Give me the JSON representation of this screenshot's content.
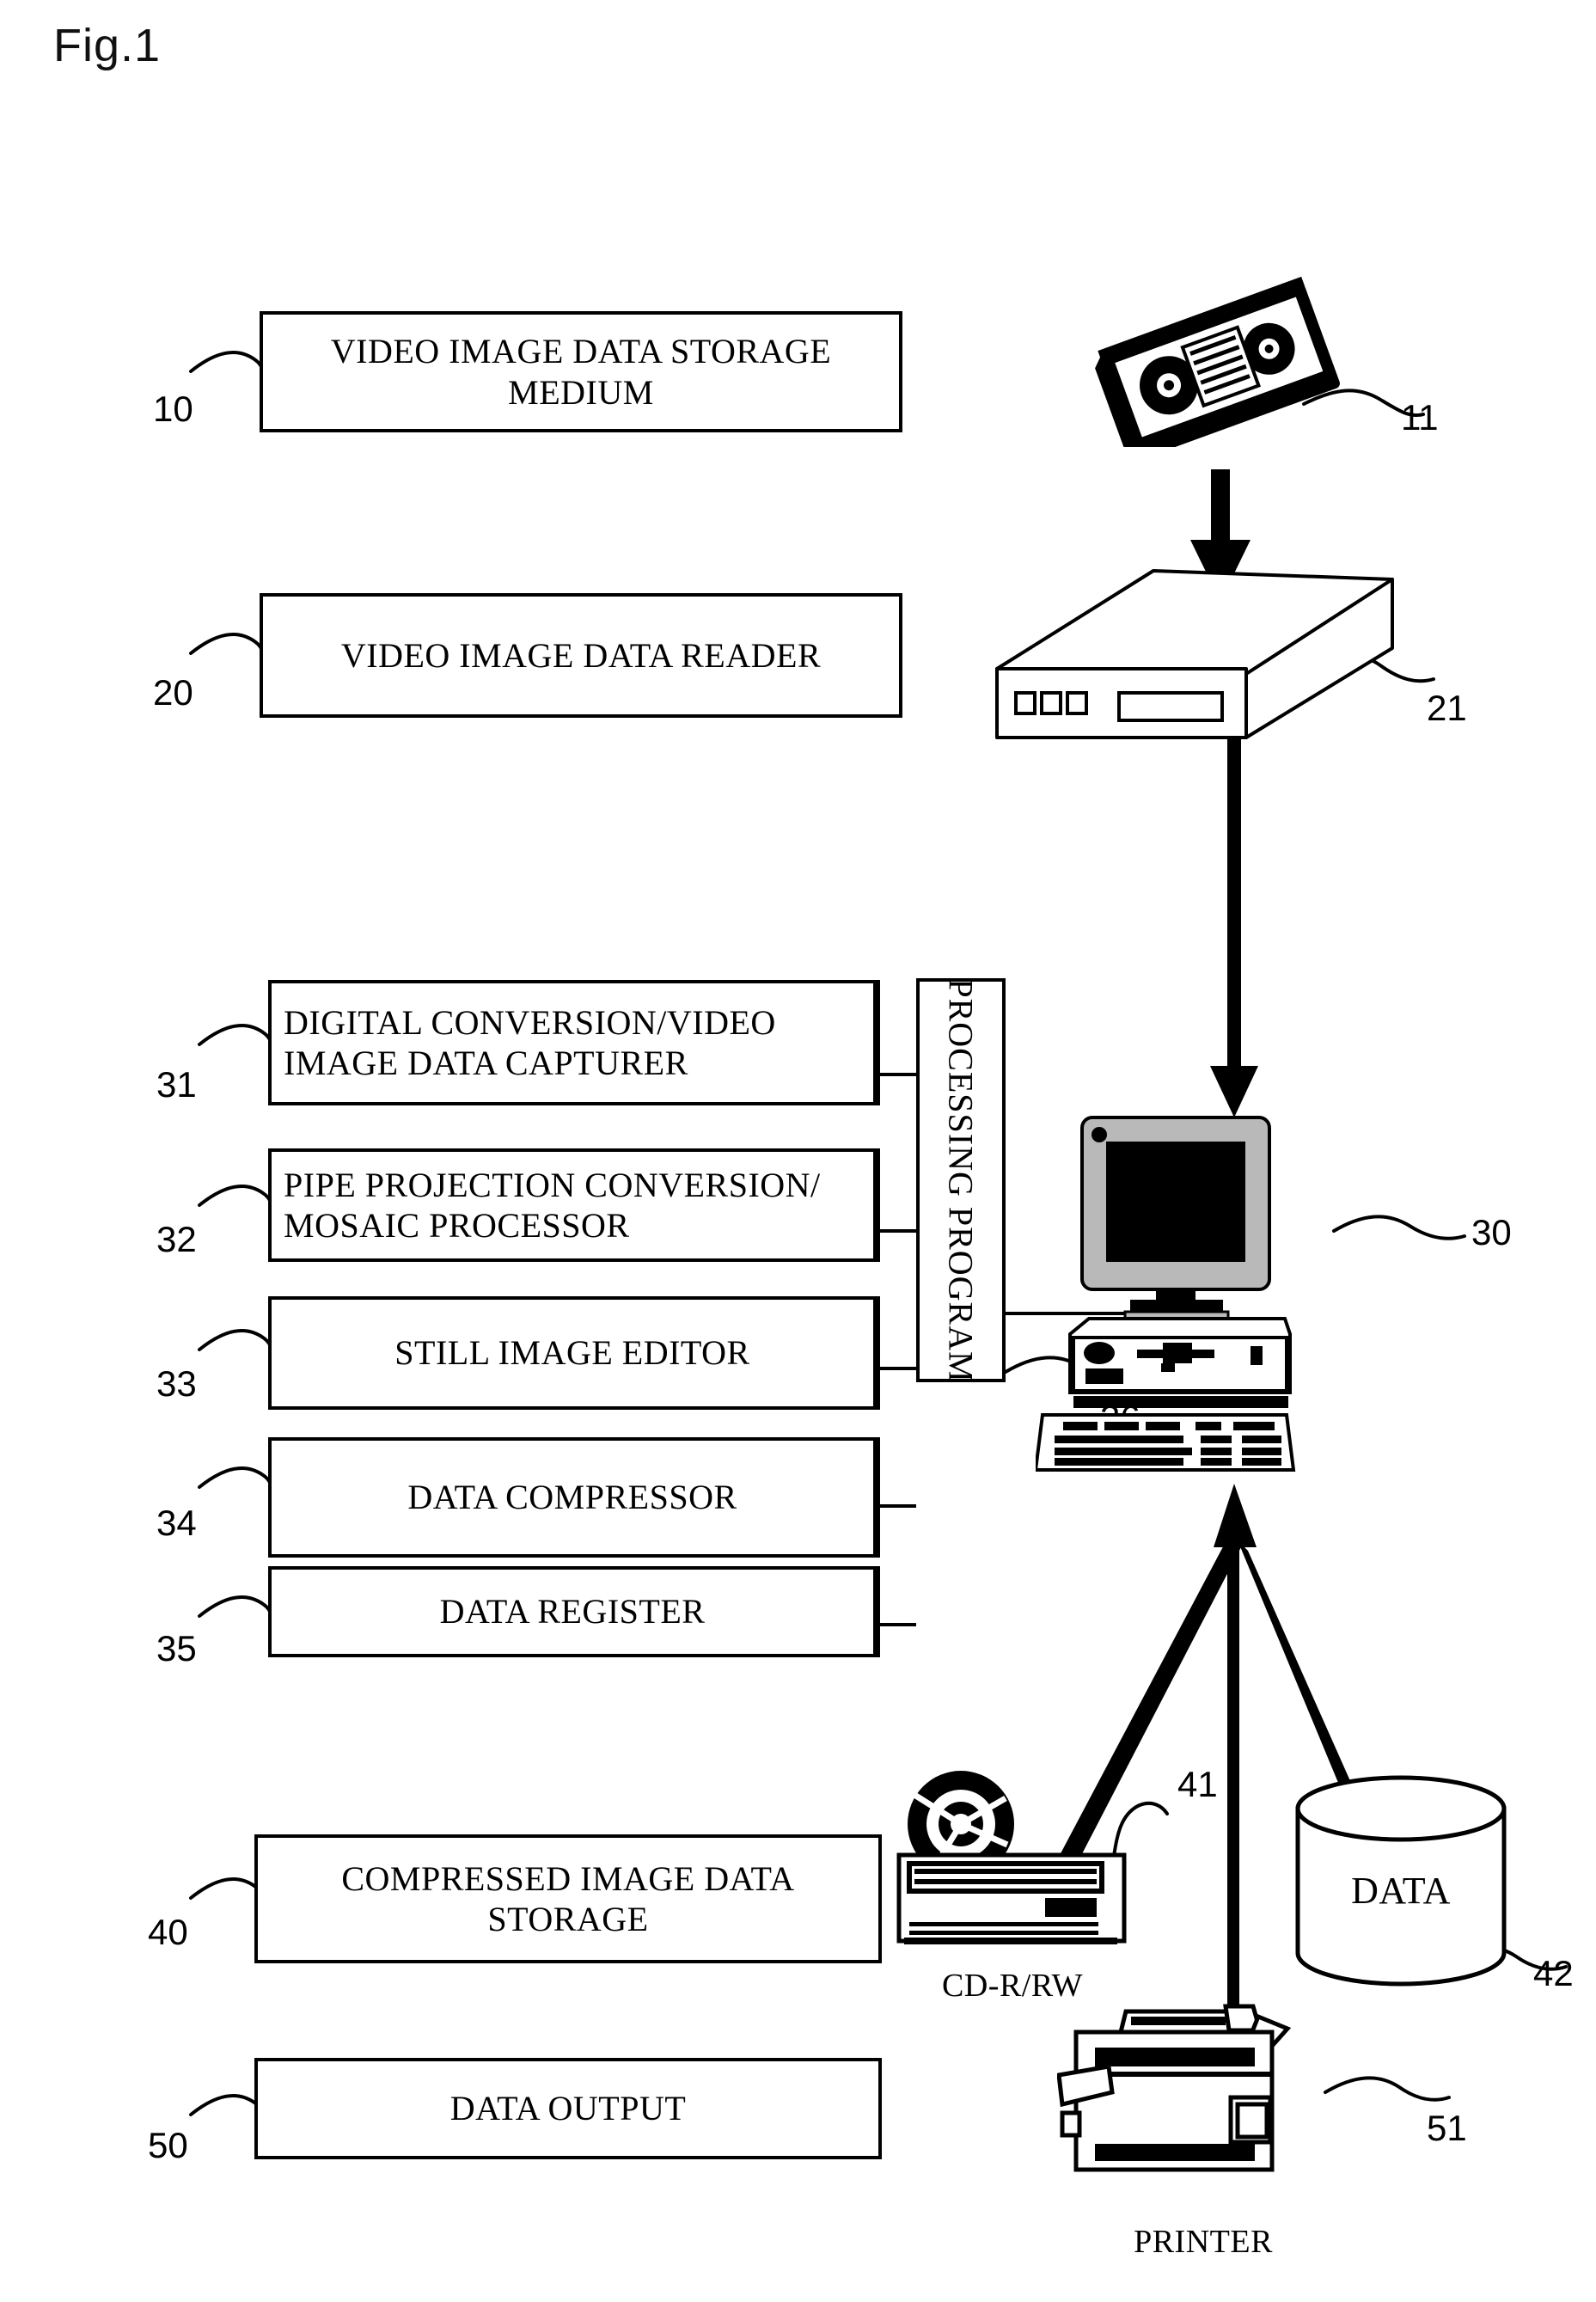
{
  "figure": {
    "label": "Fig.1"
  },
  "blocks": [
    {
      "id": "10",
      "ref": "10",
      "label": "VIDEO IMAGE DATA STORAGE MEDIUM",
      "align": "center"
    },
    {
      "id": "20",
      "ref": "20",
      "label": "VIDEO IMAGE DATA READER",
      "align": "center"
    },
    {
      "id": "31",
      "ref": "31",
      "label": "DIGITAL CONVERSION/VIDEO IMAGE DATA CAPTURER",
      "align": "left"
    },
    {
      "id": "32",
      "ref": "32",
      "label": "PIPE PROJECTION CONVERSION/ MOSAIC PROCESSOR",
      "align": "left"
    },
    {
      "id": "33",
      "ref": "33",
      "label": "STILL IMAGE EDITOR",
      "align": "center"
    },
    {
      "id": "34",
      "ref": "34",
      "label": "DATA COMPRESSOR",
      "align": "center"
    },
    {
      "id": "35",
      "ref": "35",
      "label": "DATA REGISTER",
      "align": "center"
    },
    {
      "id": "40",
      "ref": "40",
      "label": "COMPRESSED IMAGE DATA STORAGE",
      "align": "center"
    },
    {
      "id": "50",
      "ref": "50",
      "label": "DATA OUTPUT",
      "align": "center"
    }
  ],
  "processing_program": {
    "ref": "36",
    "label": "PROCESSING PROGRAM"
  },
  "pictorials": {
    "videotape": {
      "ref": "11",
      "name": "video-cassette-tape"
    },
    "video_deck": {
      "ref": "21",
      "name": "video-deck"
    },
    "computer": {
      "ref": "30",
      "name": "desktop-computer"
    },
    "cd_drive": {
      "ref": "41",
      "caption": "CD-R/RW",
      "name": "cd-rw-drive"
    },
    "data_store": {
      "ref": "42",
      "label": "DATA",
      "name": "data-cylinder"
    },
    "printer": {
      "ref": "51",
      "caption": "PRINTER",
      "name": "printer"
    }
  },
  "colors": {
    "ink": "#000000",
    "paper": "#ffffff"
  }
}
